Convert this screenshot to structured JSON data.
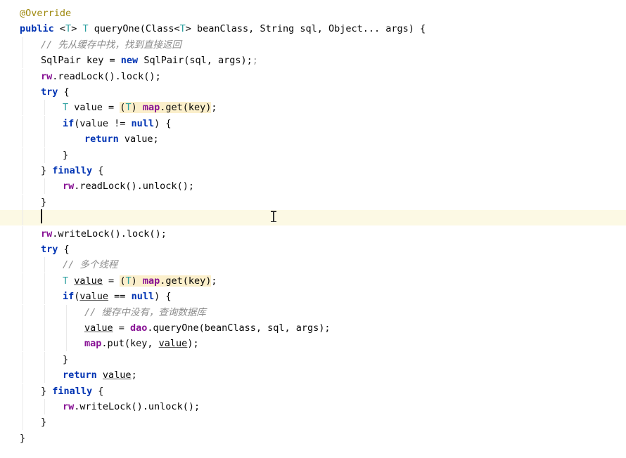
{
  "editor": {
    "lines": [
      {
        "tokens": [
          {
            "t": "@Override",
            "c": "ann"
          }
        ]
      },
      {
        "tokens": [
          {
            "t": "public",
            "c": "kw"
          },
          {
            "t": " <"
          },
          {
            "t": "T",
            "c": "tp"
          },
          {
            "t": "> "
          },
          {
            "t": "T",
            "c": "tp"
          },
          {
            "t": " queryOne(Class<"
          },
          {
            "t": "T",
            "c": "tp"
          },
          {
            "t": "> beanClass, String sql, Object... args) {"
          }
        ]
      },
      {
        "tokens": [
          {
            "t": "// 先从缓存中找，找到直接返回",
            "c": "cmt"
          }
        ]
      },
      {
        "tokens": [
          {
            "t": "SqlPair key = "
          },
          {
            "t": "new",
            "c": "kw"
          },
          {
            "t": " SqlPair(sql, args);"
          },
          {
            "t": ";",
            "c": "dim"
          }
        ]
      },
      {
        "tokens": [
          {
            "t": "rw",
            "c": "fld"
          },
          {
            "t": ".readLock().lock();"
          }
        ]
      },
      {
        "tokens": [
          {
            "t": "try",
            "c": "kw"
          },
          {
            "t": " {"
          }
        ]
      },
      {
        "tokens": [
          {
            "t": "T",
            "c": "tp"
          },
          {
            "t": " value = "
          },
          {
            "t": "(",
            "c": "hl"
          },
          {
            "t": "T",
            "c": "tp hl"
          },
          {
            "t": ") ",
            "c": "hl"
          },
          {
            "t": "map",
            "c": "fld hl"
          },
          {
            "t": ".get(key)",
            "c": "hl"
          },
          {
            "t": ";"
          }
        ]
      },
      {
        "tokens": [
          {
            "t": "if",
            "c": "kw"
          },
          {
            "t": "(value != "
          },
          {
            "t": "null",
            "c": "kw"
          },
          {
            "t": ") {"
          }
        ]
      },
      {
        "tokens": [
          {
            "t": "return",
            "c": "kw"
          },
          {
            "t": " value;"
          }
        ]
      },
      {
        "tokens": [
          {
            "t": "}"
          }
        ]
      },
      {
        "tokens": [
          {
            "t": "} "
          },
          {
            "t": "finally",
            "c": "kw"
          },
          {
            "t": " {"
          }
        ]
      },
      {
        "tokens": [
          {
            "t": "rw",
            "c": "fld"
          },
          {
            "t": ".readLock().unlock();"
          }
        ]
      },
      {
        "tokens": [
          {
            "t": "}"
          }
        ]
      },
      {
        "tokens": []
      },
      {
        "tokens": [
          {
            "t": "rw",
            "c": "fld"
          },
          {
            "t": ".writeLock().lock();"
          }
        ]
      },
      {
        "tokens": [
          {
            "t": "try",
            "c": "kw"
          },
          {
            "t": " {"
          }
        ]
      },
      {
        "tokens": [
          {
            "t": "// 多个线程",
            "c": "cmt"
          }
        ]
      },
      {
        "tokens": [
          {
            "t": "T",
            "c": "tp"
          },
          {
            "t": " "
          },
          {
            "t": "value",
            "c": "ul"
          },
          {
            "t": " = "
          },
          {
            "t": "(",
            "c": "hl"
          },
          {
            "t": "T",
            "c": "tp hl"
          },
          {
            "t": ") ",
            "c": "hl"
          },
          {
            "t": "map",
            "c": "fld hl"
          },
          {
            "t": ".get(key)",
            "c": "hl"
          },
          {
            "t": ";"
          }
        ]
      },
      {
        "tokens": [
          {
            "t": "if",
            "c": "kw"
          },
          {
            "t": "("
          },
          {
            "t": "value",
            "c": "ul"
          },
          {
            "t": " == "
          },
          {
            "t": "null",
            "c": "kw"
          },
          {
            "t": ") {"
          }
        ]
      },
      {
        "tokens": [
          {
            "t": "// 缓存中没有，查询数据库",
            "c": "cmt"
          }
        ]
      },
      {
        "tokens": [
          {
            "t": "value",
            "c": "ul"
          },
          {
            "t": " = "
          },
          {
            "t": "dao",
            "c": "fld"
          },
          {
            "t": ".queryOne(beanClass, sql, args);"
          }
        ]
      },
      {
        "tokens": [
          {
            "t": "map",
            "c": "fld"
          },
          {
            "t": ".put(key, "
          },
          {
            "t": "value",
            "c": "ul"
          },
          {
            "t": ");"
          }
        ]
      },
      {
        "tokens": [
          {
            "t": "}"
          }
        ]
      },
      {
        "tokens": [
          {
            "t": "return",
            "c": "kw"
          },
          {
            "t": " "
          },
          {
            "t": "value",
            "c": "ul"
          },
          {
            "t": ";"
          }
        ]
      },
      {
        "tokens": [
          {
            "t": "} "
          },
          {
            "t": "finally",
            "c": "kw"
          },
          {
            "t": " {"
          }
        ]
      },
      {
        "tokens": [
          {
            "t": "rw",
            "c": "fld"
          },
          {
            "t": ".writeLock().unlock();"
          }
        ]
      },
      {
        "tokens": [
          {
            "t": "}"
          }
        ]
      },
      {
        "tokens": [
          {
            "t": "}"
          }
        ]
      }
    ]
  }
}
